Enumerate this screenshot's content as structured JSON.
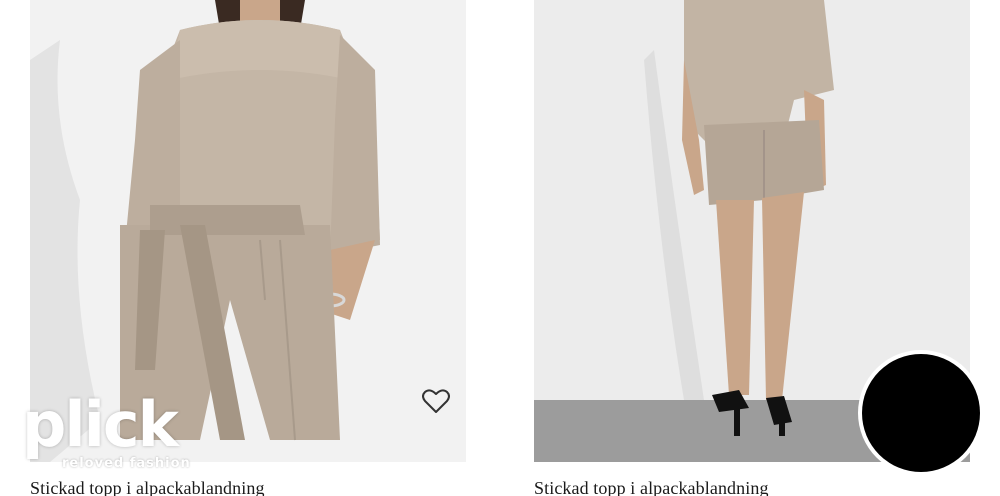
{
  "products": [
    {
      "title": "Stickad topp i alpackablandning",
      "favorite_icon": "heart-outline-icon",
      "photo_bg": "#f1f1f1"
    },
    {
      "title": "Stickad topp i alpackablandning",
      "photo_bg": "#ececec"
    }
  ],
  "watermark": {
    "logo": "plick",
    "tagline": "reloved fashion"
  },
  "colors": {
    "garment": "#bfb1a2",
    "garment_dark": "#a89a8b",
    "skin": "#c9a68a",
    "floor": "#9a9a9a",
    "overlay_circle": "#000000"
  }
}
